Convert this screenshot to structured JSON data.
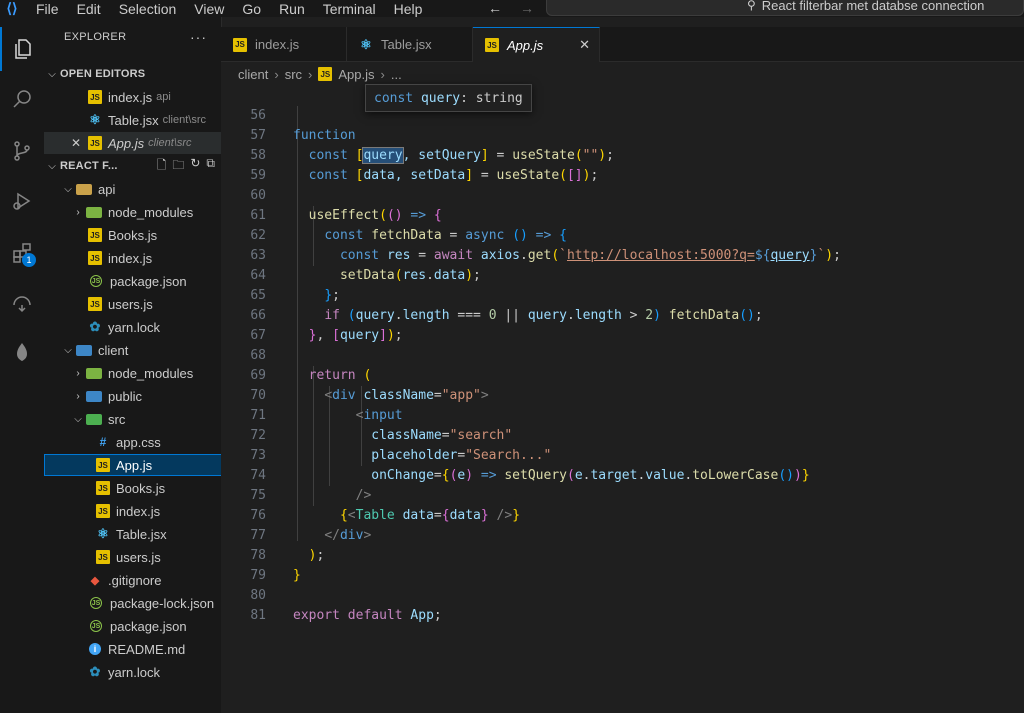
{
  "menu": [
    "File",
    "Edit",
    "Selection",
    "View",
    "Go",
    "Run",
    "Terminal",
    "Help"
  ],
  "command_center": "React filterbar met databse connection",
  "activity_badge": "1",
  "explorer": {
    "title": "EXPLORER",
    "more": "···",
    "open_editors_title": "OPEN EDITORS",
    "open_editors": [
      {
        "name": "index.js",
        "desc": "api"
      },
      {
        "name": "Table.jsx",
        "desc": "client\\src"
      },
      {
        "name": "App.js",
        "desc": "client\\src"
      }
    ],
    "workspace_title": "REACT F...",
    "tree": [
      {
        "label": "api"
      },
      {
        "label": "node_modules"
      },
      {
        "label": "Books.js"
      },
      {
        "label": "index.js"
      },
      {
        "label": "package.json"
      },
      {
        "label": "users.js"
      },
      {
        "label": "yarn.lock"
      },
      {
        "label": "client"
      },
      {
        "label": "node_modules"
      },
      {
        "label": "public"
      },
      {
        "label": "src"
      },
      {
        "label": "app.css"
      },
      {
        "label": "App.js"
      },
      {
        "label": "Books.js"
      },
      {
        "label": "index.js"
      },
      {
        "label": "Table.jsx"
      },
      {
        "label": "users.js"
      },
      {
        "label": ".gitignore"
      },
      {
        "label": "package-lock.json"
      },
      {
        "label": "package.json"
      },
      {
        "label": "README.md"
      },
      {
        "label": "yarn.lock"
      }
    ]
  },
  "tabs": [
    {
      "label": "index.js"
    },
    {
      "label": "Table.jsx"
    },
    {
      "label": "App.js",
      "close": "✕"
    }
  ],
  "breadcrumb": {
    "p1": "client",
    "p2": "src",
    "p3": "App.js",
    "p4": "..."
  },
  "hover_tooltip": {
    "kw": "const",
    "name": "query",
    "type": ": string"
  },
  "code": {
    "line_numbers": [
      "56",
      "57",
      "58",
      "59",
      "60",
      "61",
      "62",
      "63",
      "64",
      "65",
      "66",
      "67",
      "68",
      "69",
      "70",
      "71",
      "72",
      "73",
      "74",
      "75",
      "76",
      "77",
      "78",
      "79",
      "80",
      "81"
    ],
    "l56_kw": "function",
    "l57_a": "const ",
    "l57_b": "query",
    "l57_c": ", setQuery",
    "l57_d": "useState",
    "l57_e": "\"\"",
    "l58_a": "const ",
    "l58_b": "data",
    "l58_c": ", setData",
    "l58_d": "useState",
    "l60_a": "useEffect",
    "l61_a": "const ",
    "l61_b": "fetchData",
    "l61_c": "async",
    "l62_a": "const ",
    "l62_b": "res",
    "l62_c": "await ",
    "l62_d": "axios",
    "l62_e": "get",
    "l62_url": "http://localhost:5000?q=",
    "l62_var": "query",
    "l63_a": "setData",
    "l63_b": "res",
    "l63_c": "data",
    "l65_if": "if ",
    "l65_q1": "query",
    "l65_len1": "length",
    "l65_num0": "0",
    "l65_q2": "query",
    "l65_len2": "length",
    "l65_num2": "2",
    "l65_fn": "fetchData",
    "l66_q": "query",
    "l68_ret": "return ",
    "l69_tag": "div",
    "l69_attr": "className",
    "l69_str": "\"app\"",
    "l70_tag": "input",
    "l71_attr": "className",
    "l71_str": "\"search\"",
    "l72_attr": "placeholder",
    "l72_str": "\"Search...\"",
    "l73_attr": "onChange",
    "l73_e": "e",
    "l73_fn": "setQuery",
    "l73_e2": "e",
    "l73_target": "target",
    "l73_value": "value",
    "l73_lower": "toLowerCase",
    "l75_comp": "Table",
    "l75_attr": "data",
    "l75_var": "data",
    "l76_tag": "div",
    "l80_kw1": "export ",
    "l80_kw2": "default ",
    "l80_name": "App"
  }
}
